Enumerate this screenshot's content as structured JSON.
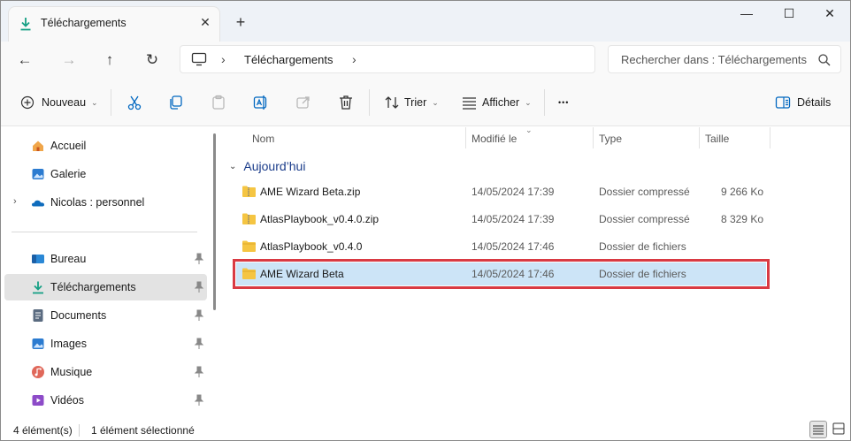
{
  "window": {
    "tab_title": "Téléchargements",
    "tab_close_glyph": "✕",
    "new_tab_glyph": "+",
    "minimize_glyph": "—",
    "maximize_glyph": "☐",
    "close_glyph": "✕"
  },
  "nav": {
    "back_glyph": "←",
    "forward_glyph": "→",
    "up_glyph": "↑",
    "refresh_glyph": "↻",
    "breadcrumb_sep": "›",
    "breadcrumb_label": "Téléchargements",
    "search_placeholder": "Rechercher dans : Téléchargements"
  },
  "toolbar": {
    "new_label": "Nouveau",
    "sort_label": "Trier",
    "view_label": "Afficher",
    "more_glyph": "•••",
    "details_label": "Détails",
    "caret_glyph": "⌄"
  },
  "sidebar": {
    "expand_glyph": "›",
    "items": [
      {
        "label": "Accueil",
        "icon": "home-icon"
      },
      {
        "label": "Galerie",
        "icon": "gallery-icon"
      },
      {
        "label": "Nicolas : personnel",
        "icon": "onedrive-icon"
      },
      {
        "label": "Bureau",
        "icon": "desktop-icon"
      },
      {
        "label": "Téléchargements",
        "icon": "download-icon"
      },
      {
        "label": "Documents",
        "icon": "documents-icon"
      },
      {
        "label": "Images",
        "icon": "images-icon"
      },
      {
        "label": "Musique",
        "icon": "music-icon"
      },
      {
        "label": "Vidéos",
        "icon": "videos-icon"
      }
    ]
  },
  "list": {
    "columns": {
      "name": "Nom",
      "modified": "Modifié le",
      "type": "Type",
      "size": "Taille"
    },
    "sort_glyph": "⌄",
    "group_chevron": "⌄",
    "group_label": "Aujourd’hui",
    "rows": [
      {
        "name": "AME Wizard Beta.zip",
        "modified": "14/05/2024 17:39",
        "type": "Dossier compressé",
        "size": "9 266 Ko",
        "icon": "zip-folder-icon"
      },
      {
        "name": "AtlasPlaybook_v0.4.0.zip",
        "modified": "14/05/2024 17:39",
        "type": "Dossier compressé",
        "size": "8 329 Ko",
        "icon": "zip-folder-icon"
      },
      {
        "name": "AtlasPlaybook_v0.4.0",
        "modified": "14/05/2024 17:46",
        "type": "Dossier de fichiers",
        "size": "",
        "icon": "folder-icon"
      },
      {
        "name": "AME Wizard Beta",
        "modified": "14/05/2024 17:46",
        "type": "Dossier de fichiers",
        "size": "",
        "icon": "folder-icon"
      }
    ]
  },
  "status": {
    "count": "4 élément(s)",
    "selection": "1 élément sélectionné"
  },
  "colors": {
    "accent": "#0067c0",
    "selection_fill": "#cce4f7",
    "highlight_outline": "#d93a43",
    "folder_yellow": "#f5c542",
    "download_green": "#16a085"
  }
}
